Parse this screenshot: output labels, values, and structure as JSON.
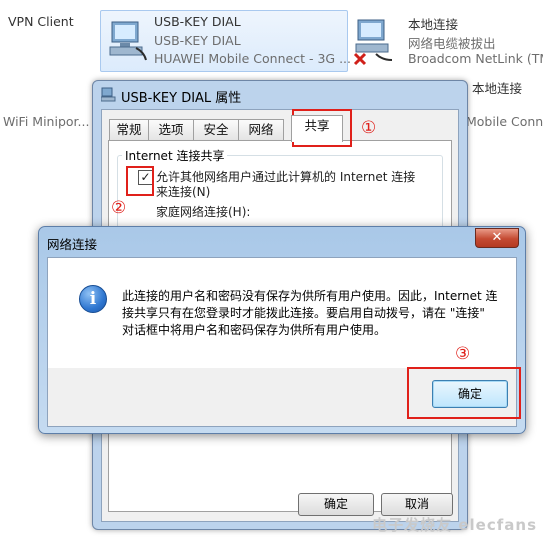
{
  "background": {
    "vpn_label": "VPN Client",
    "usbkey": {
      "name": "USB-KEY DIAL",
      "line2": "USB-KEY DIAL",
      "device": "HUAWEI Mobile Connect - 3G ..."
    },
    "local": {
      "name": "本地连接",
      "status": "网络电缆被拔出",
      "adapter": "Broadcom NetLink (TM..."
    },
    "local2_name": "本地连接",
    "wifi_label": "WiFi Minipor...",
    "mobile_label": "Mobile Conne..."
  },
  "properties_dialog": {
    "title": "USB-KEY DIAL 属性",
    "tabs": [
      "常规",
      "选项",
      "安全",
      "网络",
      "共享"
    ],
    "active_tab": "共享",
    "group_title": "Internet 连接共享",
    "checkbox_label_1": "允许其他网络用户通过此计算机的 Internet 连接",
    "checkbox_label_2": "来连接(N)",
    "checkbox_checked": true,
    "checkbox_mark": "✓",
    "home_network_label": "家庭网络连接(H):",
    "ok_label": "确定",
    "cancel_label": "取消"
  },
  "alert_dialog": {
    "title": "网络连接",
    "close_glyph": "✕",
    "info_glyph": "i",
    "message_lines": [
      "此连接的用户名和密码没有保存为供所有用户使用。因此，Internet 连",
      "接共享只有在您登录时才能拨此连接。要启用自动拨号，请在 \"连接\"",
      "对话框中将用户名和密码保存为供所有用户使用。"
    ],
    "ok_label": "确定"
  },
  "annotations": {
    "step1": "①",
    "step2": "②",
    "step3": "③"
  },
  "watermark": "电子发烧友 elecfans",
  "colors": {
    "annotation_red": "#e0201a",
    "title_bar_blue": "#bcd3ec"
  }
}
